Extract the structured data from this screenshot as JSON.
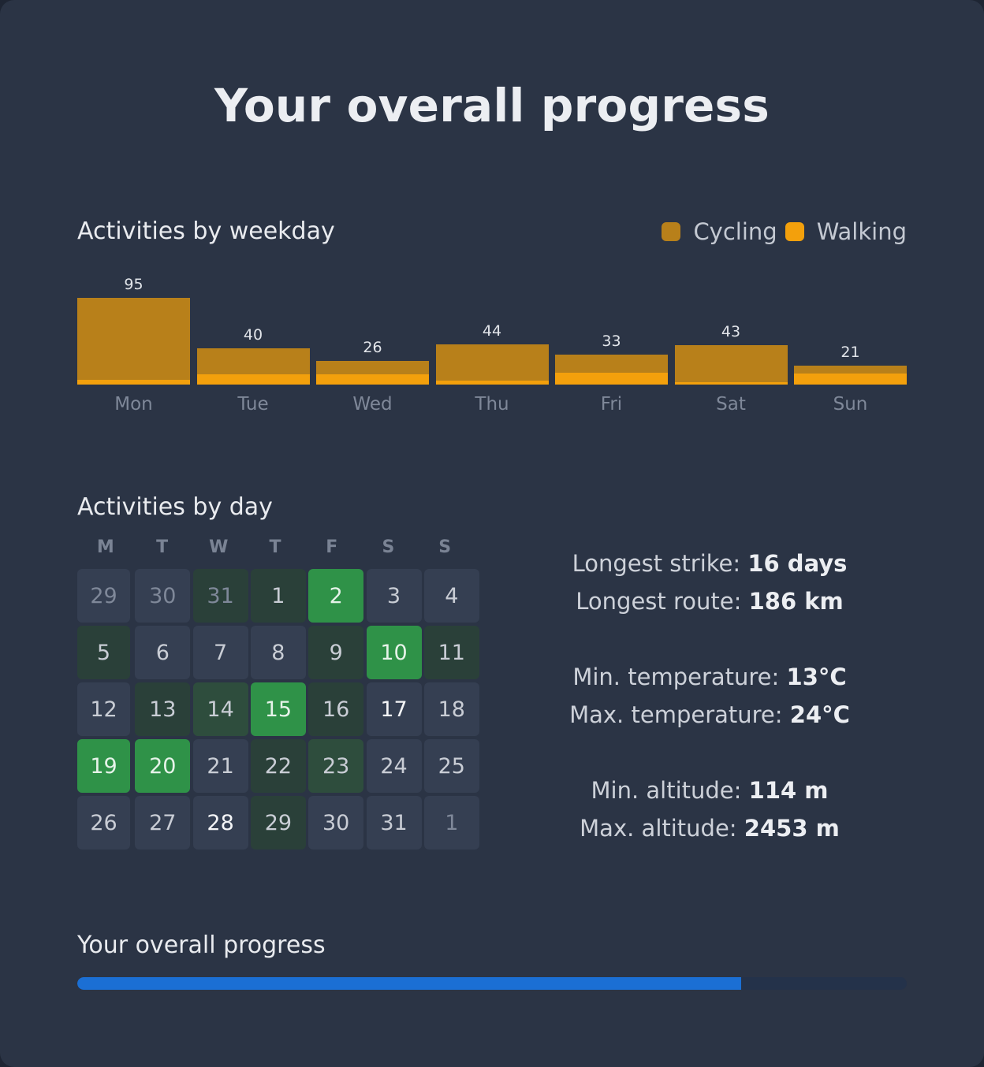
{
  "title": "Your overall progress",
  "weekday_section": {
    "title": "Activities by weekday",
    "legend": [
      {
        "label": "Cycling",
        "color": "#b8801a"
      },
      {
        "label": "Walking",
        "color": "#f3a00c"
      }
    ]
  },
  "chart_data": {
    "type": "bar",
    "categories": [
      "Mon",
      "Tue",
      "Wed",
      "Thu",
      "Fri",
      "Sat",
      "Sun"
    ],
    "totals": [
      95,
      40,
      26,
      44,
      33,
      43,
      21
    ],
    "series": [
      {
        "name": "Cycling",
        "values": [
          90,
          29,
          15,
          40,
          20,
          40,
          9
        ]
      },
      {
        "name": "Walking",
        "values": [
          5,
          11,
          11,
          4,
          13,
          3,
          12
        ]
      }
    ],
    "stacked": true
  },
  "day_section": {
    "title": "Activities by day",
    "weekday_headers": [
      "M",
      "T",
      "W",
      "T",
      "F",
      "S",
      "S"
    ],
    "days": [
      {
        "label": "29",
        "level": 0,
        "muted": true
      },
      {
        "label": "30",
        "level": 0,
        "muted": true
      },
      {
        "label": "31",
        "level": 1,
        "muted": true
      },
      {
        "label": "1",
        "level": 1
      },
      {
        "label": "2",
        "level": 3
      },
      {
        "label": "3",
        "level": 0
      },
      {
        "label": "4",
        "level": 0
      },
      {
        "label": "5",
        "level": 1
      },
      {
        "label": "6",
        "level": 0
      },
      {
        "label": "7",
        "level": 0
      },
      {
        "label": "8",
        "level": 0
      },
      {
        "label": "9",
        "level": 1
      },
      {
        "label": "10",
        "level": 3
      },
      {
        "label": "11",
        "level": 1
      },
      {
        "label": "12",
        "level": 0
      },
      {
        "label": "13",
        "level": 1
      },
      {
        "label": "14",
        "level": 2
      },
      {
        "label": "15",
        "level": 3
      },
      {
        "label": "16",
        "level": 1
      },
      {
        "label": "17",
        "level": 0,
        "bright": true
      },
      {
        "label": "18",
        "level": 0
      },
      {
        "label": "19",
        "level": 3
      },
      {
        "label": "20",
        "level": 3
      },
      {
        "label": "21",
        "level": 0
      },
      {
        "label": "22",
        "level": 1
      },
      {
        "label": "23",
        "level": 2
      },
      {
        "label": "24",
        "level": 0
      },
      {
        "label": "25",
        "level": 0
      },
      {
        "label": "26",
        "level": 0
      },
      {
        "label": "27",
        "level": 0
      },
      {
        "label": "28",
        "level": 0,
        "bright": true
      },
      {
        "label": "29",
        "level": 1
      },
      {
        "label": "30",
        "level": 0
      },
      {
        "label": "31",
        "level": 0
      },
      {
        "label": "1",
        "level": 0,
        "muted": true
      }
    ],
    "level_colors": [
      "#353f52",
      "#2a4039",
      "#2e4d3d",
      "#2f9248"
    ]
  },
  "stats": [
    [
      {
        "label": "Longest strike: ",
        "value": "16 days"
      },
      {
        "label": "Longest route: ",
        "value": "186 km"
      }
    ],
    [
      {
        "label": "Min. temperature: ",
        "value": "13°C"
      },
      {
        "label": "Max. temperature: ",
        "value": "24°C"
      }
    ],
    [
      {
        "label": "Min. altitude: ",
        "value": "114 m"
      },
      {
        "label": "Max. altitude: ",
        "value": "2453 m"
      }
    ]
  ],
  "progress_section": {
    "title": "Your overall progress",
    "value": 0.8
  }
}
